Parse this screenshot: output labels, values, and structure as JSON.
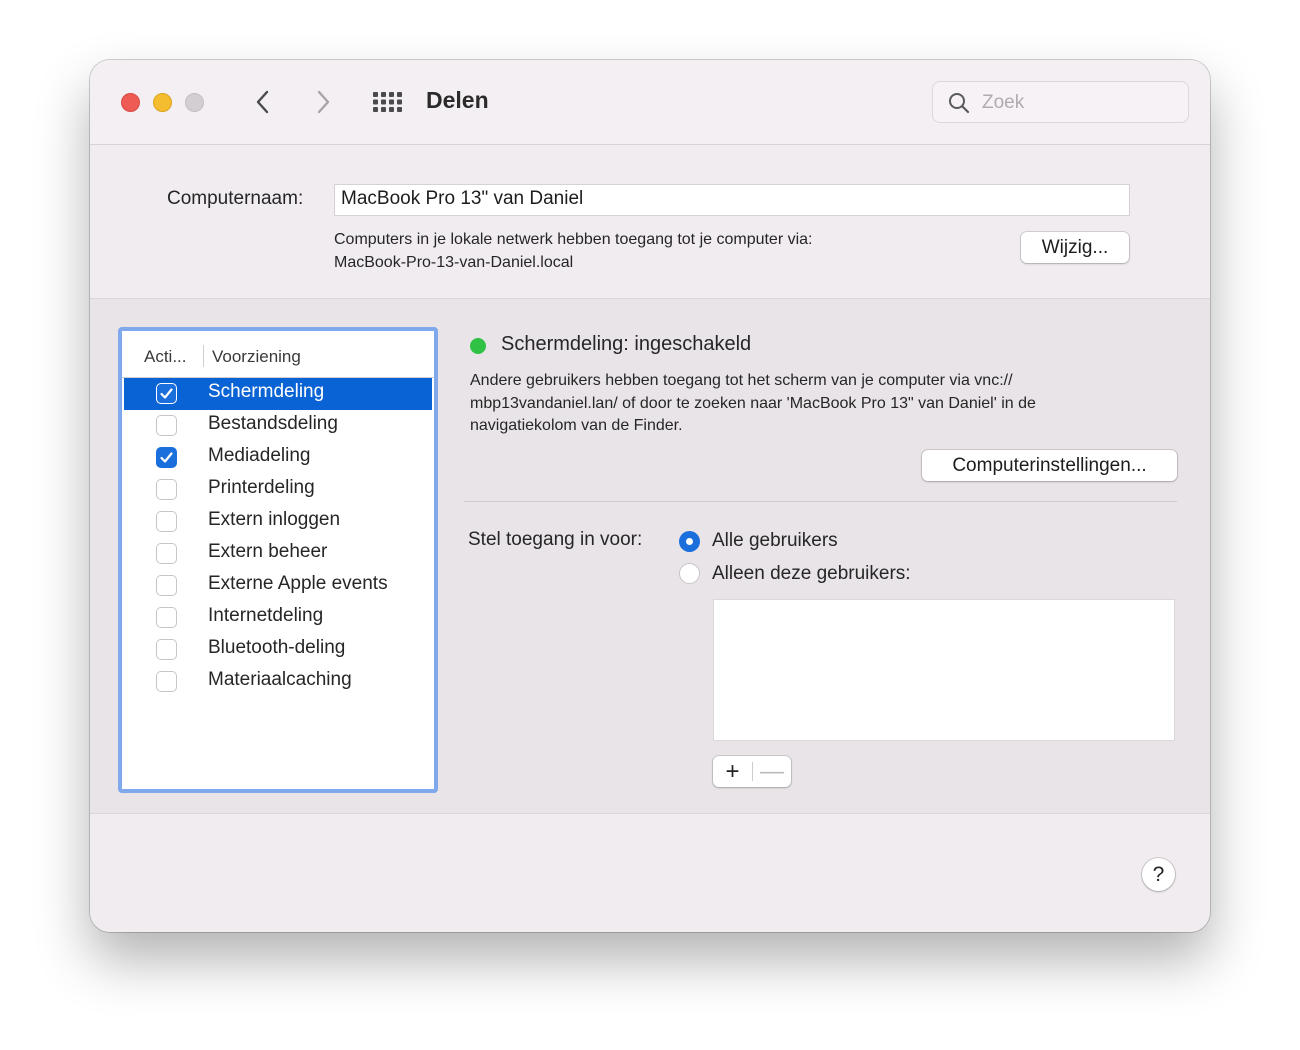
{
  "window": {
    "title": "Delen",
    "search_placeholder": "Zoek",
    "icons": {
      "back": "chevron-left-icon",
      "forward": "chevron-right-icon",
      "show_all": "grid-icon",
      "search": "search-icon"
    }
  },
  "computer": {
    "name_label": "Computernaam:",
    "name_value": "MacBook Pro 13\" van Daniel",
    "network_line1": "Computers in je lokale netwerk hebben toegang tot je computer via:",
    "network_line2": "MacBook-Pro-13-van-Daniel.local",
    "edit_button": "Wijzig..."
  },
  "services": {
    "header_active": "Acti...",
    "header_service": "Voorziening",
    "items": [
      {
        "label": "Schermdeling",
        "checked": true,
        "selected": true
      },
      {
        "label": "Bestandsdeling",
        "checked": false,
        "selected": false
      },
      {
        "label": "Mediadeling",
        "checked": true,
        "selected": false
      },
      {
        "label": "Printerdeling",
        "checked": false,
        "selected": false
      },
      {
        "label": "Extern inloggen",
        "checked": false,
        "selected": false
      },
      {
        "label": "Extern beheer",
        "checked": false,
        "selected": false
      },
      {
        "label": "Externe Apple events",
        "checked": false,
        "selected": false
      },
      {
        "label": "Internetdeling",
        "checked": false,
        "selected": false
      },
      {
        "label": "Bluetooth-deling",
        "checked": false,
        "selected": false
      },
      {
        "label": "Materiaalcaching",
        "checked": false,
        "selected": false
      }
    ]
  },
  "detail": {
    "status": "Schermdeling: ingeschakeld",
    "status_color": "#2fc244",
    "description_line1": "Andere gebruikers hebben toegang tot het scherm van je computer via vnc://",
    "description_line2": "mbp13vandaniel.lan/ of door te zoeken naar 'MacBook Pro 13\" van Daniel' in de",
    "description_line3": "navigatiekolom van de Finder.",
    "settings_button": "Computerinstellingen...",
    "access_label": "Stel toegang in voor:",
    "option_all": "Alle gebruikers",
    "option_only": "Alleen deze gebruikers:",
    "selected_option": "Alle gebruikers",
    "add_button": "+",
    "remove_button": "—"
  },
  "help_button": "?",
  "colors": {
    "accent": "#0a63d4",
    "selection": "#0a63d4",
    "focus_ring": "#7fa9ec"
  }
}
